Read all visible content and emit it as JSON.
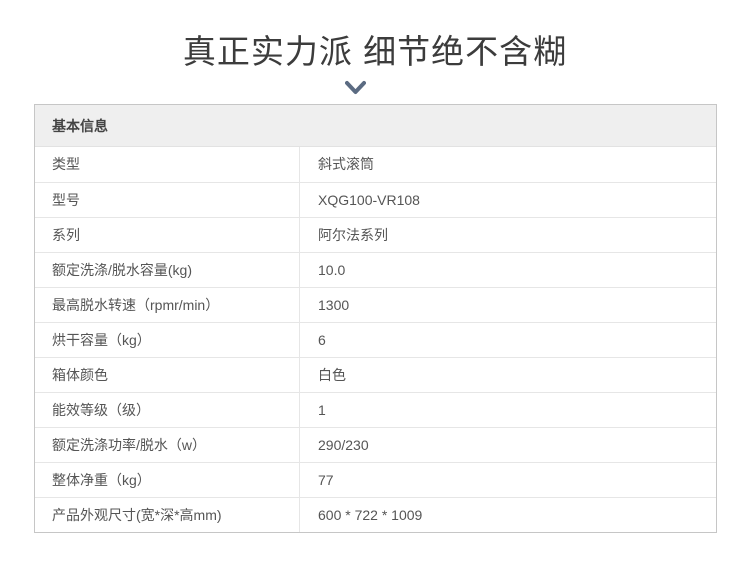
{
  "headline": "真正实力派 细节绝不含糊",
  "icons": {
    "divider": "chevron-down-icon"
  },
  "colors": {
    "chevron": "#5b6b82",
    "header_bg": "#efefef",
    "border": "#c6c6c6"
  },
  "spec": {
    "section_title": "基本信息",
    "rows": [
      {
        "label": "类型",
        "value": "斜式滚筒"
      },
      {
        "label": "型号",
        "value": "XQG100-VR108"
      },
      {
        "label": "系列",
        "value": "阿尔法系列"
      },
      {
        "label": "额定洗涤/脱水容量(kg)",
        "value": "10.0"
      },
      {
        "label": "最高脱水转速（rpmr/min）",
        "value": "1300"
      },
      {
        "label": "烘干容量（kg）",
        "value": "6"
      },
      {
        "label": "箱体颜色",
        "value": "白色"
      },
      {
        "label": "能效等级（级）",
        "value": "1"
      },
      {
        "label": "额定洗涤功率/脱水（w）",
        "value": "290/230"
      },
      {
        "label": "整体净重（kg）",
        "value": "77"
      },
      {
        "label": "产品外观尺寸(宽*深*高mm)",
        "value": "600 * 722 * 1009"
      }
    ]
  }
}
